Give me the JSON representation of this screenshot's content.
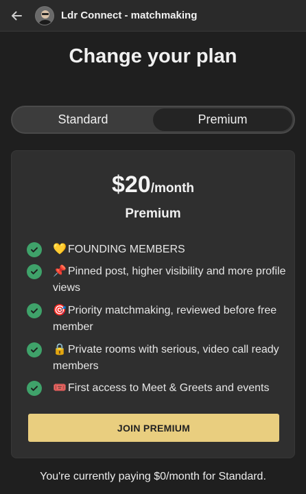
{
  "header": {
    "app_title": "Ldr Connect - matchmaking"
  },
  "page": {
    "title": "Change your plan"
  },
  "plan_toggle": {
    "options": [
      "Standard",
      "Premium"
    ],
    "selected": "Premium"
  },
  "card": {
    "price_amount": "$20",
    "price_period": "/month",
    "plan_name": "Premium",
    "features": [
      {
        "emoji": "💛",
        "text": "FOUNDING MEMBERS"
      },
      {
        "emoji": "📌",
        "text": "Pinned post, higher visibility and more profile views"
      },
      {
        "emoji": "🎯",
        "text": "Priority matchmaking, reviewed before free member"
      },
      {
        "emoji": "🔒",
        "text": "Private rooms with serious, video call ready members"
      },
      {
        "emoji": "🎟️",
        "text": "First access to Meet & Greets and events"
      }
    ],
    "cta_label": "JOIN PREMIUM"
  },
  "footer": {
    "note": "You're currently paying $0/month for Standard."
  },
  "colors": {
    "accent": "#e9ce7f",
    "check": "#3fa26a",
    "background": "#1f1f1f"
  }
}
